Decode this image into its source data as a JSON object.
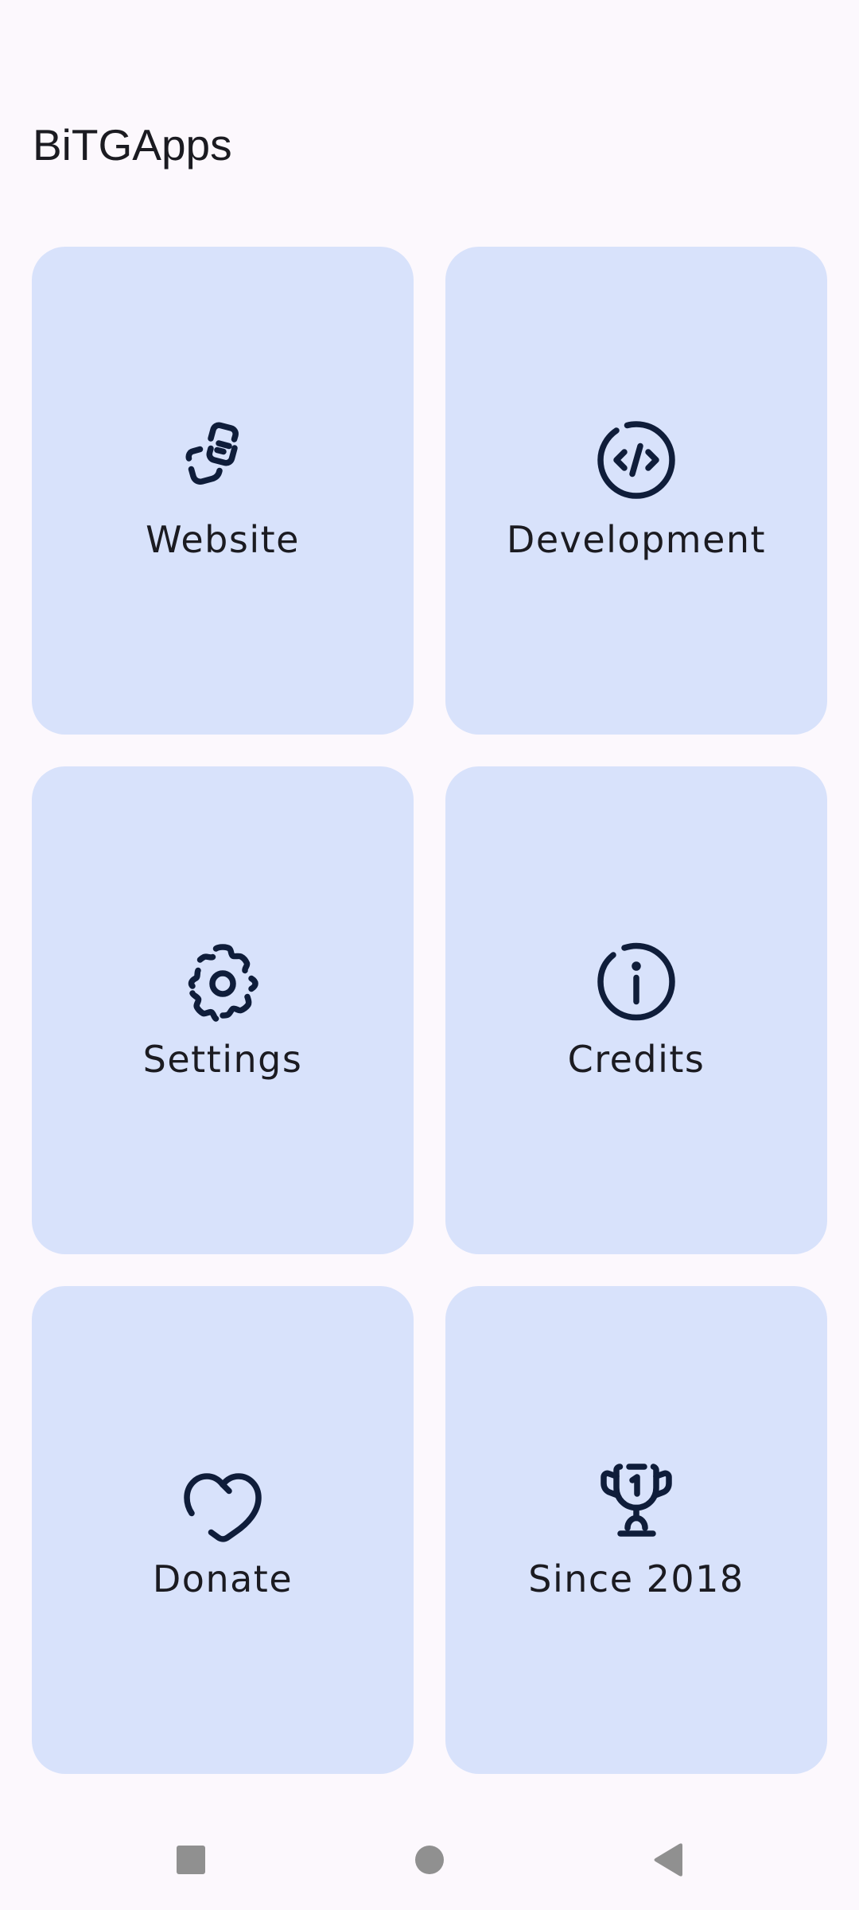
{
  "app": {
    "title": "BiTGApps"
  },
  "cards": [
    {
      "id": "website",
      "label": "Website",
      "icon": "website-icon"
    },
    {
      "id": "development",
      "label": "Development",
      "icon": "code-icon"
    },
    {
      "id": "settings",
      "label": "Settings",
      "icon": "gear-icon"
    },
    {
      "id": "credits",
      "label": "Credits",
      "icon": "info-icon"
    },
    {
      "id": "donate",
      "label": "Donate",
      "icon": "heart-icon"
    },
    {
      "id": "since",
      "label": "Since 2018",
      "icon": "trophy-icon"
    }
  ],
  "navbar": {
    "buttons": [
      "recents",
      "home",
      "back"
    ]
  },
  "colors": {
    "background": "#fcf8fd",
    "card": "#d8e2fb",
    "icon": "#0f1d3a",
    "text": "#1b1b21",
    "nav": "#909090"
  }
}
